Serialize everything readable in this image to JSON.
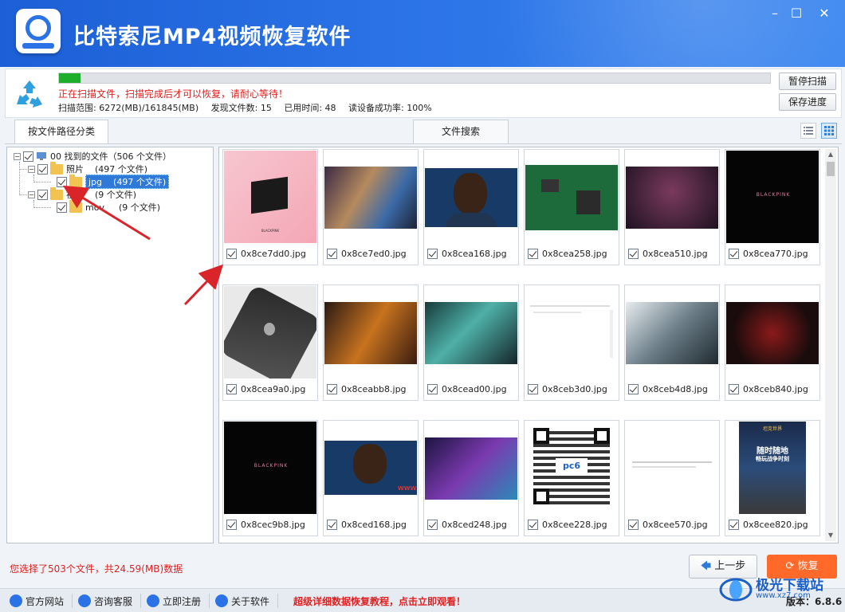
{
  "app": {
    "title": "比特索尼MP4视频恢复软件",
    "window_controls": [
      "minimize",
      "maximize",
      "close"
    ]
  },
  "scan": {
    "progress_fraction": 0.03,
    "message": "正在扫描文件，扫描完成后才可以恢复，请耐心等待！",
    "range": "扫描范围: 6272(MB)/161845(MB)",
    "found": "发现文件数: 15",
    "elapsed": "已用时间: 48",
    "read_success": "读设备成功率: 100%",
    "pause_button": "暂停扫描",
    "save_button": "保存进度"
  },
  "tabs": {
    "by_path": "按文件路径分类",
    "file_search": "文件搜索"
  },
  "tree": {
    "root": "00 找到的文件（506 个文件）",
    "photos": "照片",
    "photos_count": "(497 个文件)",
    "jpg": "jpg",
    "jpg_count": "(497 个文件)",
    "video": "视频",
    "video_count": "(9 个文件)",
    "mov": "mov",
    "mov_count": "(9 个文件)"
  },
  "files": [
    {
      "name": "0x8ce7dd0.jpg",
      "checked": true
    },
    {
      "name": "0x8ce7ed0.jpg",
      "checked": true
    },
    {
      "name": "0x8cea168.jpg",
      "checked": true
    },
    {
      "name": "0x8cea258.jpg",
      "checked": true
    },
    {
      "name": "0x8cea510.jpg",
      "checked": true
    },
    {
      "name": "0x8cea770.jpg",
      "checked": true
    },
    {
      "name": "0x8cea9a0.jpg",
      "checked": true
    },
    {
      "name": "0x8ceabb8.jpg",
      "checked": true
    },
    {
      "name": "0x8cead00.jpg",
      "checked": true
    },
    {
      "name": "0x8ceb3d0.jpg",
      "checked": true
    },
    {
      "name": "0x8ceb4d8.jpg",
      "checked": true
    },
    {
      "name": "0x8ceb840.jpg",
      "checked": true
    },
    {
      "name": "0x8cec9b8.jpg",
      "checked": true
    },
    {
      "name": "0x8ced168.jpg",
      "checked": true
    },
    {
      "name": "0x8ced248.jpg",
      "checked": true
    },
    {
      "name": "0x8cee228.jpg",
      "checked": true
    },
    {
      "name": "0x8cee570.jpg",
      "checked": true
    },
    {
      "name": "0x8cee820.jpg",
      "checked": true
    }
  ],
  "thumb_texts": {
    "blackpink": "BLACKPINK",
    "www": "WWW",
    "pc6": "pc6",
    "game_logo": "坦克世界",
    "game_headline_1": "随时随地",
    "game_headline_2": "畅玩战争时刻"
  },
  "bottom": {
    "selection_summary": "您选择了503个文件，共24.59(MB)数据",
    "prev_button": "上一步",
    "recover_button": "恢复"
  },
  "footer": {
    "official_site": "官方网站",
    "support": "咨询客服",
    "register": "立即注册",
    "about": "关于软件",
    "tutorial": "超级详细数据恢复教程，点击立即观看！",
    "version": "版本：6.8.6"
  },
  "watermark": {
    "text": "极光下载站",
    "url": "www.xz7.com"
  },
  "colors": {
    "title_bar": "#2a72e6",
    "progress": "#1fae2c",
    "alert_text": "#e02020",
    "recover_button": "#ff6a2b",
    "selection": "#2f7ad8"
  }
}
